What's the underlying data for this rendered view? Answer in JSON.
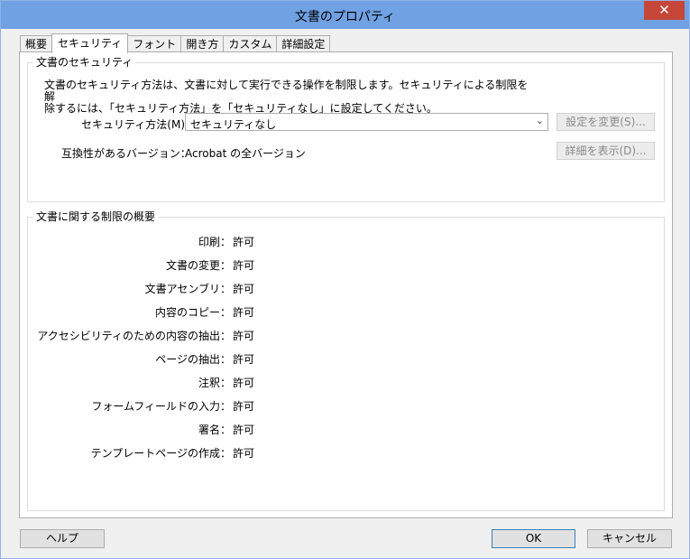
{
  "window": {
    "title": "文書のプロパティ",
    "close_glyph": "✕"
  },
  "tabs": [
    {
      "label": "概要"
    },
    {
      "label": "セキュリティ",
      "active": true
    },
    {
      "label": "フォント"
    },
    {
      "label": "開き方"
    },
    {
      "label": "カスタム"
    },
    {
      "label": "詳細設定"
    }
  ],
  "security": {
    "legend": "文書のセキュリティ",
    "description_line1": "文書のセキュリティ方法は、文書に対して実行できる操作を制限します。セキュリティによる制限を解",
    "description_line2": "除するには、「セキュリティ方法」を「セキュリティなし」に設定してください。",
    "method_label": "セキュリティ方法(M)：",
    "method_value": "セキュリティなし",
    "change_settings_label": "設定を変更(S)...",
    "compat_label": "互換性があるバージョン：",
    "compat_value": "Acrobat の全バージョン",
    "show_details_label": "詳細を表示(D)..."
  },
  "restrictions": {
    "legend": "文書に関する制限の概要",
    "items": [
      {
        "name": "印刷：",
        "value": "許可"
      },
      {
        "name": "文書の変更：",
        "value": "許可"
      },
      {
        "name": "文書アセンブリ：",
        "value": "許可"
      },
      {
        "name": "内容のコピー：",
        "value": "許可"
      },
      {
        "name": "アクセシビリティのための内容の抽出：",
        "value": "許可"
      },
      {
        "name": "ページの抽出：",
        "value": "許可"
      },
      {
        "name": "注釈：",
        "value": "許可"
      },
      {
        "name": "フォームフィールドの入力：",
        "value": "許可"
      },
      {
        "name": "署名：",
        "value": "許可"
      },
      {
        "name": "テンプレートページの作成：",
        "value": "許可"
      }
    ]
  },
  "footer": {
    "help_label": "ヘルプ",
    "ok_label": "OK",
    "cancel_label": "キャンセル"
  },
  "colors": {
    "titlebar": "#6fa1e3",
    "close": "#c7463a",
    "dialog_bg": "#f0f0f0"
  }
}
